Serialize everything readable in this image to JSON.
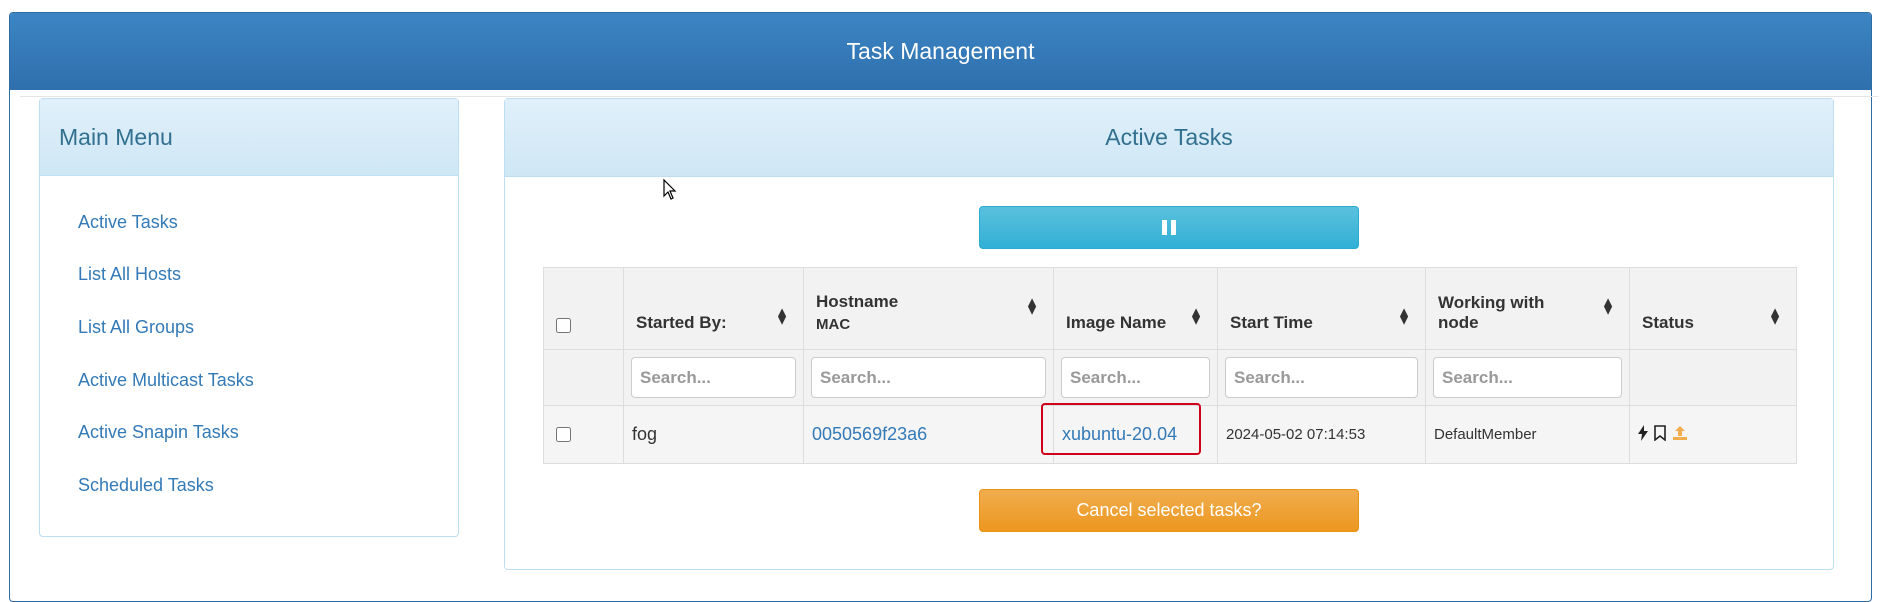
{
  "header": {
    "title": "Task Management"
  },
  "menu": {
    "title": "Main Menu",
    "items": [
      {
        "label": "Active Tasks"
      },
      {
        "label": "List All Hosts"
      },
      {
        "label": "List All Groups"
      },
      {
        "label": "Active Multicast Tasks"
      },
      {
        "label": "Active Snapin Tasks"
      },
      {
        "label": "Scheduled Tasks"
      }
    ]
  },
  "main": {
    "title": "Active Tasks",
    "pause_icon": "pause-icon",
    "table": {
      "columns": [
        {
          "label": "Started By:"
        },
        {
          "label": "Hostname",
          "sub": "MAC"
        },
        {
          "label": "Image Name"
        },
        {
          "label": "Start Time"
        },
        {
          "label": "Working with node"
        },
        {
          "label": "Status"
        }
      ],
      "search_placeholder": "Search...",
      "rows": [
        {
          "started_by": "fog",
          "hostname": "0050569f23a6",
          "image_name": "xubuntu-20.04",
          "start_time": "2024-05-02 07:14:53",
          "node": "DefaultMember",
          "status_icons": [
            "bolt-icon",
            "bookmark-icon",
            "upload-icon"
          ]
        }
      ]
    },
    "cancel_label": "Cancel selected tasks?"
  },
  "colors": {
    "header_blue": "#337ab7",
    "panel_heading": "#d9edf7",
    "info_button": "#5bc0de",
    "warning_button": "#f0ad4e",
    "highlight": "#d0021b"
  }
}
